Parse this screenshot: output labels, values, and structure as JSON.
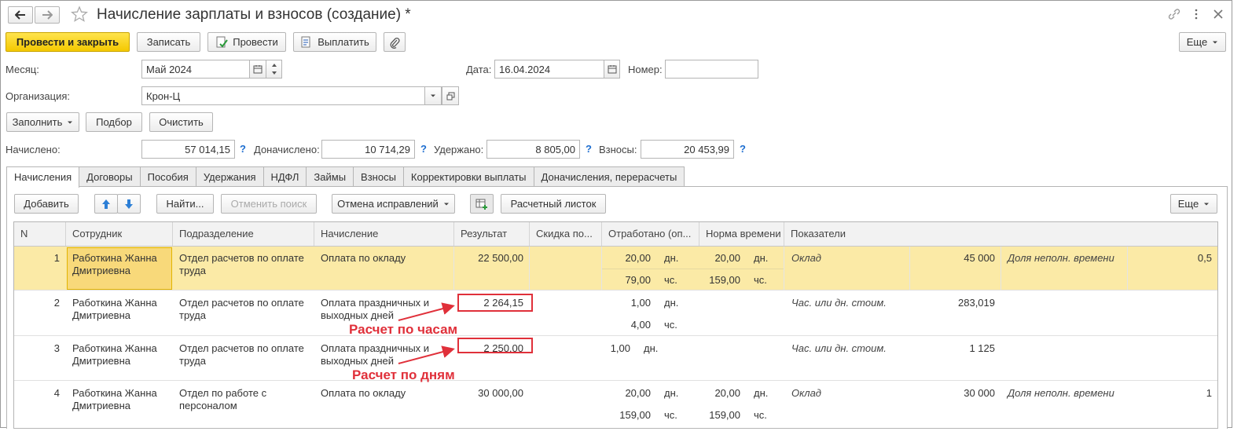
{
  "window": {
    "title": "Начисление зарплаты и взносов (создание) *"
  },
  "toolbar": {
    "post_close": "Провести и закрыть",
    "save": "Записать",
    "post": "Провести",
    "pay": "Выплатить",
    "more": "Еще"
  },
  "form": {
    "month_label": "Месяц:",
    "month_value": "Май 2024",
    "date_label": "Дата:",
    "date_value": "16.04.2024",
    "number_label": "Номер:",
    "number_value": "",
    "org_label": "Организация:",
    "org_value": "Крон-Ц",
    "fill": "Заполнить",
    "pick": "Подбор",
    "clear": "Очистить"
  },
  "totals": {
    "accrued_label": "Начислено:",
    "accrued_value": "57 014,15",
    "extra_label": "Доначислено:",
    "extra_value": "10 714,29",
    "withheld_label": "Удержано:",
    "withheld_value": "8 805,00",
    "contrib_label": "Взносы:",
    "contrib_value": "20 453,99",
    "q": "?"
  },
  "tabs": [
    "Начисления",
    "Договоры",
    "Пособия",
    "Удержания",
    "НДФЛ",
    "Займы",
    "Взносы",
    "Корректировки выплаты",
    "Доначисления, перерасчеты"
  ],
  "tab_toolbar": {
    "add": "Добавить",
    "find": "Найти...",
    "cancel_search": "Отменить поиск",
    "cancel_fix": "Отмена исправлений",
    "payslip": "Расчетный листок",
    "more": "Еще"
  },
  "columns": [
    "N",
    "Сотрудник",
    "Подразделение",
    "Начисление",
    "Результат",
    "Скидка по...",
    "Отработано (оп...",
    "Норма времени",
    "Показатели"
  ],
  "rows": [
    {
      "n": "1",
      "employee": [
        "Работкина Жанна",
        "Дмитриевна"
      ],
      "dept": [
        "Отдел расчетов по оплате",
        "труда"
      ],
      "accrual": [
        "Оплата по окладу"
      ],
      "result": "22 500,00",
      "worked": [
        [
          "20,00",
          "дн."
        ],
        [
          "79,00",
          "чс."
        ]
      ],
      "norm": [
        [
          "20,00",
          "дн."
        ],
        [
          "159,00",
          "чс."
        ]
      ],
      "ind1_name": "Оклад",
      "ind1_val": "45 000",
      "ind2_name": "Доля неполн. времени",
      "ind2_val": "0,5"
    },
    {
      "n": "2",
      "employee": [
        "Работкина Жанна",
        "Дмитриевна"
      ],
      "dept": [
        "Отдел расчетов по оплате",
        "труда"
      ],
      "accrual": [
        "Оплата праздничных и",
        "выходных дней"
      ],
      "result": "2 264,15",
      "worked": [
        [
          "1,00",
          "дн."
        ],
        [
          "4,00",
          "чс."
        ]
      ],
      "norm": [],
      "ind1_name": "Час. или дн. стоим.",
      "ind1_val": "283,019",
      "ind2_name": "",
      "ind2_val": ""
    },
    {
      "n": "3",
      "employee": [
        "Работкина Жанна",
        "Дмитриевна"
      ],
      "dept": [
        "Отдел расчетов по оплате",
        "труда"
      ],
      "accrual": [
        "Оплата праздничных и",
        "выходных дней"
      ],
      "result": "2 250,00",
      "worked": [
        [
          "1,00",
          "дн."
        ]
      ],
      "norm": [],
      "ind1_name": "Час. или дн. стоим.",
      "ind1_val": "1 125",
      "ind2_name": "",
      "ind2_val": ""
    },
    {
      "n": "4",
      "employee": [
        "Работкина Жанна",
        "Дмитриевна"
      ],
      "dept": [
        "Отдел по работе с",
        "персоналом"
      ],
      "accrual": [
        "Оплата по окладу"
      ],
      "result": "30 000,00",
      "worked": [
        [
          "20,00",
          "дн."
        ],
        [
          "159,00",
          "чс."
        ]
      ],
      "norm": [
        [
          "20,00",
          "дн."
        ],
        [
          "159,00",
          "чс."
        ]
      ],
      "ind1_name": "Оклад",
      "ind1_val": "30 000",
      "ind2_name": "Доля неполн. времени",
      "ind2_val": "1"
    }
  ],
  "annotations": {
    "hours": "Расчет по часам",
    "days": "Расчет по дням"
  },
  "colors": {
    "accent": "#f4c800",
    "selected_row": "#fbeaa6",
    "annotation": "#e0303a",
    "link": "#1e6ed0"
  }
}
